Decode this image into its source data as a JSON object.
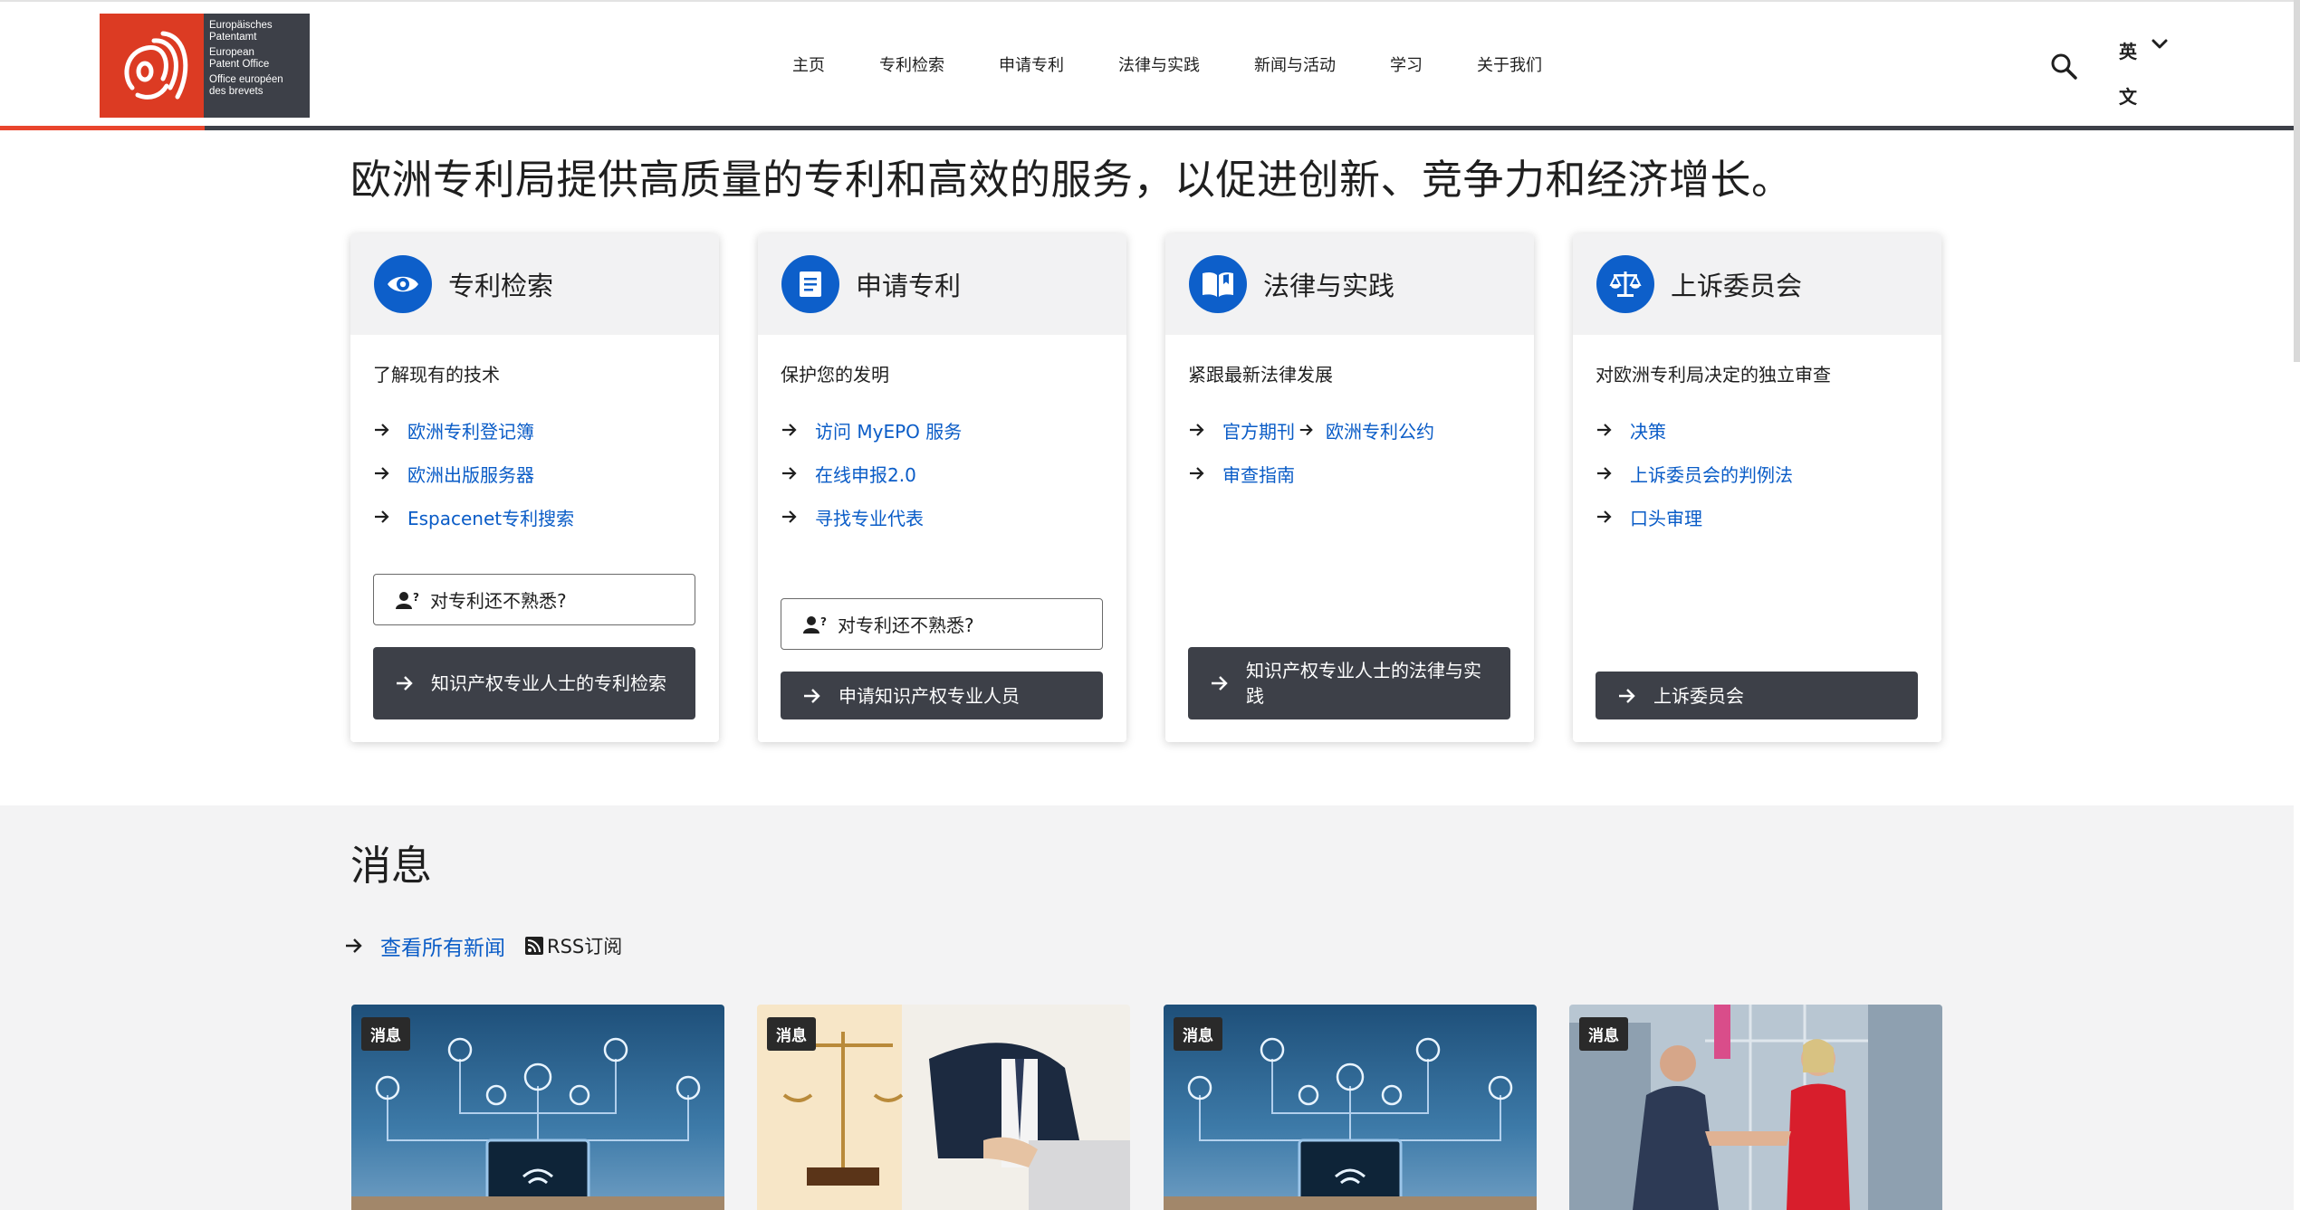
{
  "logo": {
    "lines": [
      "Europäisches",
      "Patentamt",
      "European",
      "Patent Office",
      "Office européen",
      "des brevets"
    ]
  },
  "nav": {
    "items": [
      "主页",
      "专利检索",
      "申请专利",
      "法律与实践",
      "新闻与活动",
      "学习",
      "关于我们"
    ]
  },
  "language": {
    "line1": "英",
    "line2": "文"
  },
  "hero": {
    "title": "欧洲专利局提供高质量的专利和高效的服务，以促进创新、竞争力和经济增长。"
  },
  "cards": [
    {
      "title": "专利检索",
      "icon": "eye-icon",
      "description": "了解现有的技术",
      "links": [
        "欧洲专利登记簿",
        "欧洲出版服务器",
        "Espacenet专利搜索"
      ],
      "outline_button": "对专利还不熟悉?",
      "dark_button": "知识产权专业人士的专利检索"
    },
    {
      "title": "申请专利",
      "icon": "document-icon",
      "description": "保护您的发明",
      "links": [
        "访问 MyEPO 服务",
        "在线申报2.0",
        "寻找专业代表"
      ],
      "outline_button": "对专利还不熟悉?",
      "dark_button": "申请知识产权专业人员"
    },
    {
      "title": "法律与实践",
      "icon": "book-icon",
      "description": "紧跟最新法律发展",
      "links": [
        "官方期刊",
        "欧洲专利公约",
        "审查指南"
      ],
      "dark_button": "知识产权专业人士的法律与实践"
    },
    {
      "title": "上诉委员会",
      "icon": "scales-icon",
      "description": "对欧洲专利局决定的独立审查",
      "links": [
        "决策",
        "上诉委员会的判例法",
        "口头审理"
      ],
      "dark_button": "上诉委员会"
    }
  ],
  "news": {
    "title": "消息",
    "all_news_link": "查看所有新闻",
    "rss_label": "RSS订阅",
    "badge": "消息"
  },
  "colors": {
    "brand_red": "#dc3b23",
    "dark_gray": "#3d4048",
    "accent_blue": "#0d5fca",
    "link_blue": "#0a5cc7"
  }
}
